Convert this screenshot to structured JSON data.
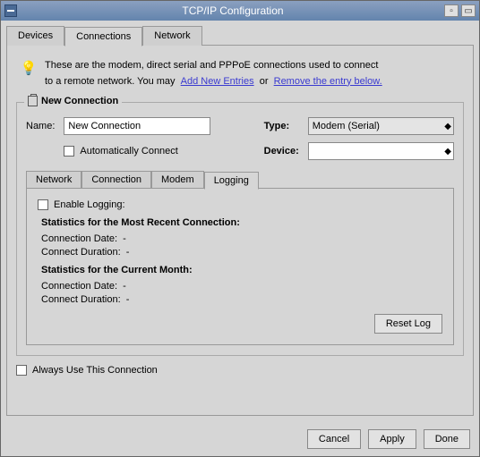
{
  "window": {
    "title": "TCP/IP Configuration"
  },
  "main_tabs": {
    "devices": "Devices",
    "connections": "Connections",
    "network": "Network"
  },
  "info": {
    "text1": "These are the modem, direct serial and PPPoE connections used to connect",
    "text2": "to a remote network. You may",
    "link_add": "Add New Entries",
    "text_or": "or",
    "link_remove": "Remove the entry below."
  },
  "section": {
    "title": "New Connection",
    "name_label": "Name:",
    "name_value": "New Connection",
    "auto_connect": "Automatically Connect",
    "type_label": "Type:",
    "type_value": "Modem (Serial)",
    "device_label": "Device:",
    "device_value": ""
  },
  "inner_tabs": {
    "network": "Network",
    "connection": "Connection",
    "modem": "Modem",
    "logging": "Logging"
  },
  "logging": {
    "enable": "Enable Logging:",
    "stats_recent": "Statistics for the Most Recent Connection:",
    "conn_date": "Connection Date:",
    "conn_dur": "Connect Duration:",
    "stats_month": "Statistics for the Current Month:",
    "conn_date2": "Connection Date:",
    "conn_dur2": "Connect Duration:",
    "dash": "-",
    "reset": "Reset Log"
  },
  "always_use": "Always Use This Connection",
  "footer": {
    "cancel": "Cancel",
    "apply": "Apply",
    "done": "Done"
  }
}
